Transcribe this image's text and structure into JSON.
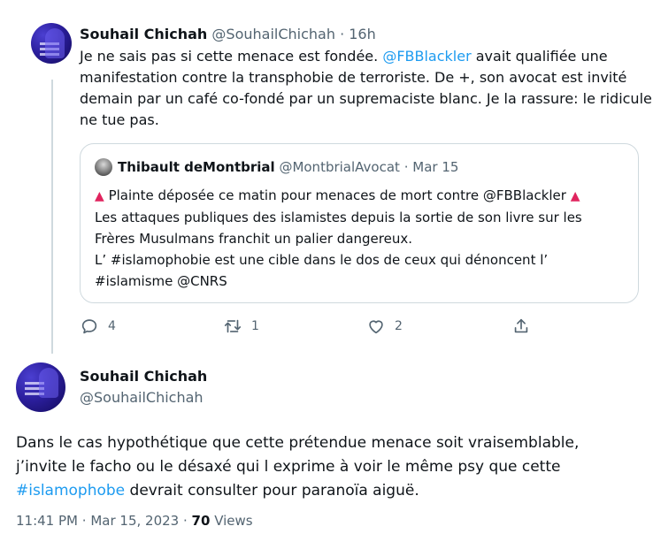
{
  "tweet1": {
    "name": "Souhail Chichah",
    "handle": "@SouhailChichah",
    "sep": "·",
    "time": "16h",
    "line1_a": "Je ne sais pas si cette menace est fondée. ",
    "line1_mention": "@FBBlackler",
    "line1_b": " avait qualifiée une",
    "line2": "manifestation contre la transphobie de terroriste. De +, son avocat est invité",
    "line3": "demain par un café co-fondé par un supremaciste blanc. Je la rassure: le ridicule",
    "line4": "ne tue pas.",
    "quote": {
      "name": "Thibault deMontbrial",
      "handle": "@MontbrialAvocat",
      "sep": "·",
      "date": "Mar 15",
      "warn_icon": "▲",
      "line1": "Plainte déposée ce matin pour menaces de mort contre @FBBlackler",
      "line2": "Les attaques publiques des islamistes depuis la sortie de son livre sur les",
      "line3": "Frères Musulmans franchit un palier dangereux.",
      "line4": "L’ #islamophobie est une cible dans le dos de ceux qui dénoncent l’",
      "line5": "#islamisme @CNRS"
    },
    "actions": {
      "replies": "4",
      "retweets": "1",
      "likes": "2"
    }
  },
  "tweet2": {
    "name": "Souhail Chichah",
    "handle": "@SouhailChichah",
    "line1": "Dans le cas hypothétique que cette prétendue menace soit vraisemblable,",
    "line2": "j’invite le facho ou le désaxé qui l exprime à voir le même psy que cette",
    "line3_hashtag": "#islamophobe",
    "line3_rest": " devrait consulter pour paranoïa aiguë.",
    "meta_time": "11:41 PM",
    "meta_sep1": "·",
    "meta_date": "Mar 15, 2023",
    "meta_sep2": "·",
    "views_count": "70",
    "views_label": " Views"
  },
  "colors": {
    "link": "#1d9bf0",
    "muted": "#536471",
    "warning": "#e0245e"
  }
}
